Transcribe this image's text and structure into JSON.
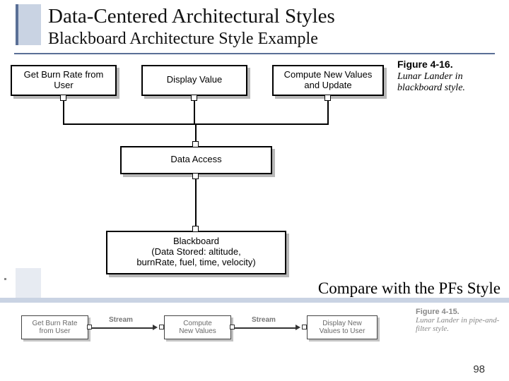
{
  "title": {
    "main": "Data-Centered Architectural Styles",
    "sub": "Blackboard Architecture Style Example"
  },
  "figure_main": {
    "number": "Figure 4-16.",
    "text": "Lunar Lander in blackboard style."
  },
  "boxes": {
    "burn": "Get Burn Rate from User",
    "display": "Display Value",
    "compute": "Compute New Values and Update",
    "access": "Data Access",
    "blackboard": "Blackboard\n(Data Stored: altitude,\nburnRate, fuel, time, velocity)"
  },
  "compare": "Compare with the PFs Style",
  "pfs": {
    "burn": "Get Burn Rate\nfrom User",
    "compute": "Compute\nNew Values",
    "display": "Display New\nValues to User",
    "stream": "Stream"
  },
  "figure_pfs": {
    "number": "Figure 4-15.",
    "text": "Lunar Lander in pipe-and-filter style."
  },
  "page": "98"
}
